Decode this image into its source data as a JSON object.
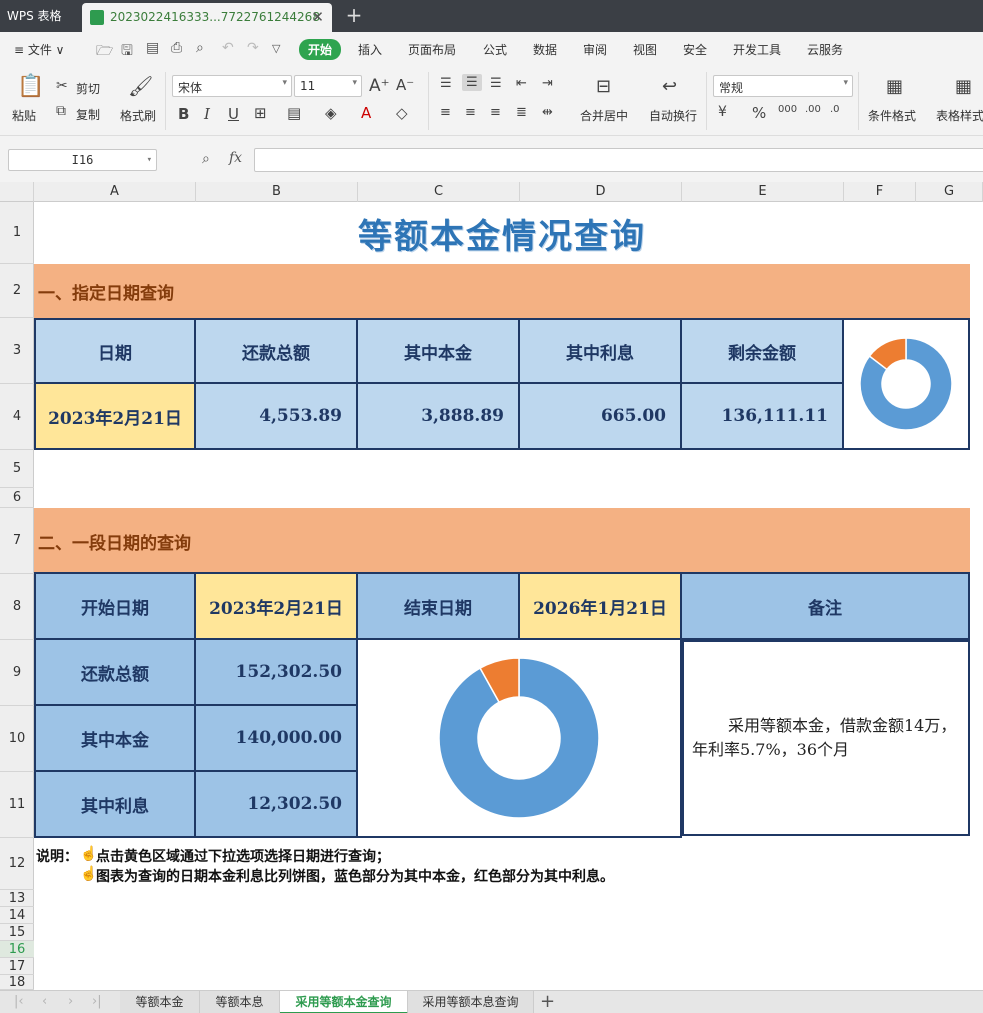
{
  "window": {
    "app_tab": "WPS 表格",
    "doc_tab": "2023022416333...7722761244268",
    "close": "✕",
    "new_tab": "+"
  },
  "menu": {
    "file": "≡ 文件 ∨",
    "items": [
      "开始",
      "插入",
      "页面布局",
      "公式",
      "数据",
      "审阅",
      "视图",
      "安全",
      "开发工具",
      "云服务"
    ]
  },
  "ribbon": {
    "paste": "粘贴",
    "cut": "剪切",
    "copy": "复制",
    "format_painter": "格式刷",
    "font_name": "宋体",
    "font_size": "11",
    "merge_center": "合并居中",
    "wrap_text": "自动换行",
    "number_format": "常规",
    "cond_format": "条件格式",
    "table_style": "表格样式"
  },
  "formula_bar": {
    "name_box": "I16",
    "fx": "fx"
  },
  "columns": [
    "A",
    "B",
    "C",
    "D",
    "E",
    "F",
    "G"
  ],
  "rows": [
    "1",
    "2",
    "3",
    "4",
    "5",
    "6",
    "7",
    "8",
    "9",
    "10",
    "11",
    "12",
    "13",
    "14",
    "15",
    "16",
    "17",
    "18"
  ],
  "sheet": {
    "title": "等额本金情况查询",
    "section1": "一、指定日期查询",
    "headers1": [
      "日期",
      "还款总额",
      "其中本金",
      "其中利息",
      "剩余金额"
    ],
    "values1": [
      "2023年2月21日",
      "4,553.89",
      "3,888.89",
      "665.00",
      "136,111.11"
    ],
    "section2": "二、一段日期的查询",
    "start_label": "开始日期",
    "start_value": "2023年2月21日",
    "end_label": "结束日期",
    "end_value": "2026年1月21日",
    "remark_label": "备注",
    "row_labels": [
      "还款总额",
      "其中本金",
      "其中利息"
    ],
    "row_values": [
      "152,302.50",
      "140,000.00",
      "12,302.50"
    ],
    "remark_text": "采用等额本金，借款金额14万，年利率5.7%，36个月",
    "note_prefix": "说明：",
    "note1": "点击黄色区域通过下拉选项选择日期进行查询；",
    "note2": "图表为查询的日期本金利息比列饼图，蓝色部分为其中本金，红色部分为其中利息。"
  },
  "chart_data": [
    {
      "type": "pie",
      "categories": [
        "其中本金",
        "其中利息"
      ],
      "values": [
        3888.89,
        665.0
      ],
      "colors": [
        "#5b9bd5",
        "#ed7d31"
      ]
    },
    {
      "type": "pie",
      "categories": [
        "其中本金",
        "其中利息"
      ],
      "values": [
        140000.0,
        12302.5
      ],
      "colors": [
        "#5b9bd5",
        "#ed7d31"
      ]
    }
  ],
  "tabs": [
    "等额本金",
    "等额本息",
    "采用等额本金查询",
    "采用等额本息查询"
  ],
  "active_tab": "采用等额本金查询",
  "add_sheet": "+"
}
